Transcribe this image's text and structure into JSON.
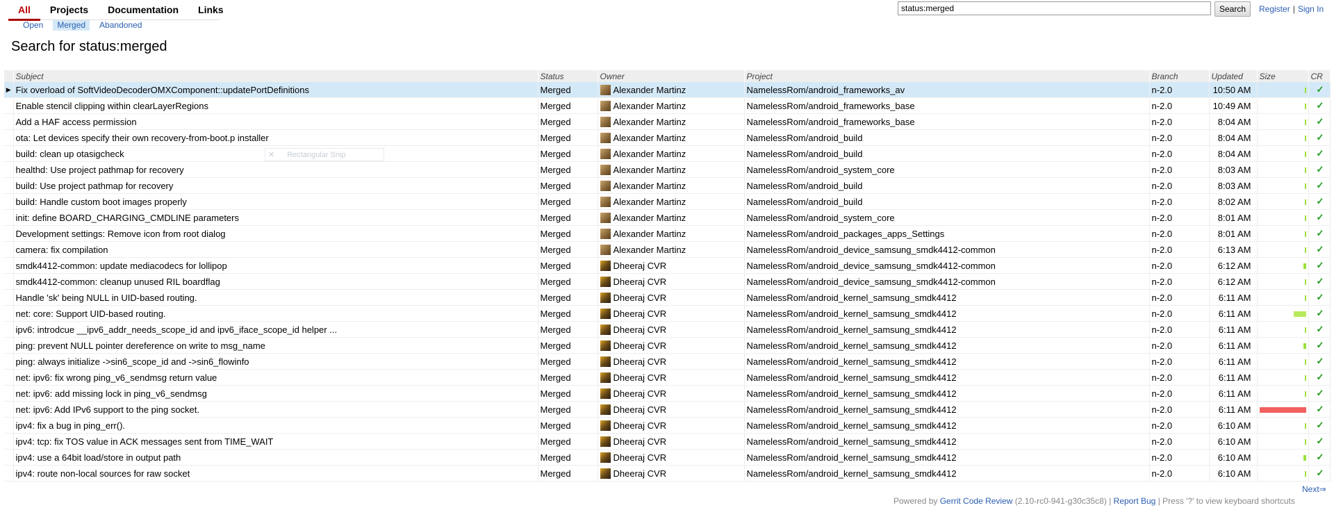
{
  "nav": {
    "tabs": [
      {
        "label": "All",
        "active": true
      },
      {
        "label": "Projects",
        "active": false
      },
      {
        "label": "Documentation",
        "active": false
      },
      {
        "label": "Links",
        "active": false
      }
    ],
    "subtabs": [
      {
        "label": "Open",
        "active": false
      },
      {
        "label": "Merged",
        "active": true
      },
      {
        "label": "Abandoned",
        "active": false
      }
    ]
  },
  "search": {
    "value": "status:merged",
    "button_label": "Search"
  },
  "user_links": {
    "register": "Register",
    "separator": "|",
    "sign_in": "Sign In"
  },
  "page_title": "Search for status:merged",
  "columns": {
    "subject": "Subject",
    "status": "Status",
    "owner": "Owner",
    "project": "Project",
    "branch": "Branch",
    "updated": "Updated",
    "size": "Size",
    "cr": "CR"
  },
  "rows": [
    {
      "subject": "Fix overload of SoftVideoDecoderOMXComponent::updatePortDefinitions",
      "status": "Merged",
      "owner": "Alexander Martinz",
      "project": "NamelessRom/android_frameworks_av",
      "branch": "n-2.0",
      "updated": "10:50 AM",
      "size_fraction": 0.03,
      "size_color": "#99e03a",
      "cr": "✓"
    },
    {
      "subject": "Enable stencil clipping within clearLayerRegions",
      "status": "Merged",
      "owner": "Alexander Martinz",
      "project": "NamelessRom/android_frameworks_base",
      "branch": "n-2.0",
      "updated": "10:49 AM",
      "size_fraction": 0.03,
      "size_color": "#99e03a",
      "cr": "✓"
    },
    {
      "subject": "Add a HAF access permission",
      "status": "Merged",
      "owner": "Alexander Martinz",
      "project": "NamelessRom/android_frameworks_base",
      "branch": "n-2.0",
      "updated": "8:04 AM",
      "size_fraction": 0.03,
      "size_color": "#99e03a",
      "cr": "✓"
    },
    {
      "subject": "ota: Let devices specify their own recovery-from-boot.p installer",
      "status": "Merged",
      "owner": "Alexander Martinz",
      "project": "NamelessRom/android_build",
      "branch": "n-2.0",
      "updated": "8:04 AM",
      "size_fraction": 0.03,
      "size_color": "#99e03a",
      "cr": "✓"
    },
    {
      "subject": "build: clean up otasigcheck",
      "status": "Merged",
      "owner": "Alexander Martinz",
      "project": "NamelessRom/android_build",
      "branch": "n-2.0",
      "updated": "8:04 AM",
      "size_fraction": 0.03,
      "size_color": "#99e03a",
      "cr": "✓"
    },
    {
      "subject": "healthd: Use project pathmap for recovery",
      "status": "Merged",
      "owner": "Alexander Martinz",
      "project": "NamelessRom/android_system_core",
      "branch": "n-2.0",
      "updated": "8:03 AM",
      "size_fraction": 0.03,
      "size_color": "#99e03a",
      "cr": "✓"
    },
    {
      "subject": "build: Use project pathmap for recovery",
      "status": "Merged",
      "owner": "Alexander Martinz",
      "project": "NamelessRom/android_build",
      "branch": "n-2.0",
      "updated": "8:03 AM",
      "size_fraction": 0.03,
      "size_color": "#99e03a",
      "cr": "✓"
    },
    {
      "subject": "build: Handle custom boot images properly",
      "status": "Merged",
      "owner": "Alexander Martinz",
      "project": "NamelessRom/android_build",
      "branch": "n-2.0",
      "updated": "8:02 AM",
      "size_fraction": 0.03,
      "size_color": "#99e03a",
      "cr": "✓"
    },
    {
      "subject": "init: define BOARD_CHARGING_CMDLINE parameters",
      "status": "Merged",
      "owner": "Alexander Martinz",
      "project": "NamelessRom/android_system_core",
      "branch": "n-2.0",
      "updated": "8:01 AM",
      "size_fraction": 0.03,
      "size_color": "#99e03a",
      "cr": "✓"
    },
    {
      "subject": "Development settings: Remove icon from root dialog",
      "status": "Merged",
      "owner": "Alexander Martinz",
      "project": "NamelessRom/android_packages_apps_Settings",
      "branch": "n-2.0",
      "updated": "8:01 AM",
      "size_fraction": 0.03,
      "size_color": "#99e03a",
      "cr": "✓"
    },
    {
      "subject": "camera: fix compilation",
      "status": "Merged",
      "owner": "Alexander Martinz",
      "project": "NamelessRom/android_device_samsung_smdk4412-common",
      "branch": "n-2.0",
      "updated": "6:13 AM",
      "size_fraction": 0.03,
      "size_color": "#99e03a",
      "cr": "✓"
    },
    {
      "subject": "smdk4412-common: update mediacodecs for lollipop",
      "status": "Merged",
      "owner": "Dheeraj CVR",
      "project": "NamelessRom/android_device_samsung_smdk4412-common",
      "branch": "n-2.0",
      "updated": "6:12 AM",
      "size_fraction": 0.05,
      "size_color": "#99e03a",
      "cr": "✓"
    },
    {
      "subject": "smdk4412-common: cleanup unused RIL boardflag",
      "status": "Merged",
      "owner": "Dheeraj CVR",
      "project": "NamelessRom/android_device_samsung_smdk4412-common",
      "branch": "n-2.0",
      "updated": "6:12 AM",
      "size_fraction": 0.03,
      "size_color": "#99e03a",
      "cr": "✓"
    },
    {
      "subject": "Handle 'sk' being NULL in UID-based routing.",
      "status": "Merged",
      "owner": "Dheeraj CVR",
      "project": "NamelessRom/android_kernel_samsung_smdk4412",
      "branch": "n-2.0",
      "updated": "6:11 AM",
      "size_fraction": 0.03,
      "size_color": "#99e03a",
      "cr": "✓"
    },
    {
      "subject": "net: core: Support UID-based routing.",
      "status": "Merged",
      "owner": "Dheeraj CVR",
      "project": "NamelessRom/android_kernel_samsung_smdk4412",
      "branch": "n-2.0",
      "updated": "6:11 AM",
      "size_fraction": 0.25,
      "size_color": "#b8ea5c",
      "cr": "✓"
    },
    {
      "subject": "ipv6: introdcue __ipv6_addr_needs_scope_id and ipv6_iface_scope_id helper ...",
      "status": "Merged",
      "owner": "Dheeraj CVR",
      "project": "NamelessRom/android_kernel_samsung_smdk4412",
      "branch": "n-2.0",
      "updated": "6:11 AM",
      "size_fraction": 0.03,
      "size_color": "#99e03a",
      "cr": "✓"
    },
    {
      "subject": "ping: prevent NULL pointer dereference on write to msg_name",
      "status": "Merged",
      "owner": "Dheeraj CVR",
      "project": "NamelessRom/android_kernel_samsung_smdk4412",
      "branch": "n-2.0",
      "updated": "6:11 AM",
      "size_fraction": 0.05,
      "size_color": "#99e03a",
      "cr": "✓"
    },
    {
      "subject": "ping: always initialize ->sin6_scope_id and ->sin6_flowinfo",
      "status": "Merged",
      "owner": "Dheeraj CVR",
      "project": "NamelessRom/android_kernel_samsung_smdk4412",
      "branch": "n-2.0",
      "updated": "6:11 AM",
      "size_fraction": 0.03,
      "size_color": "#99e03a",
      "cr": "✓"
    },
    {
      "subject": "net: ipv6: fix wrong ping_v6_sendmsg return value",
      "status": "Merged",
      "owner": "Dheeraj CVR",
      "project": "NamelessRom/android_kernel_samsung_smdk4412",
      "branch": "n-2.0",
      "updated": "6:11 AM",
      "size_fraction": 0.03,
      "size_color": "#99e03a",
      "cr": "✓"
    },
    {
      "subject": "net: ipv6: add missing lock in ping_v6_sendmsg",
      "status": "Merged",
      "owner": "Dheeraj CVR",
      "project": "NamelessRom/android_kernel_samsung_smdk4412",
      "branch": "n-2.0",
      "updated": "6:11 AM",
      "size_fraction": 0.03,
      "size_color": "#99e03a",
      "cr": "✓"
    },
    {
      "subject": "net: ipv6: Add IPv6 support to the ping socket.",
      "status": "Merged",
      "owner": "Dheeraj CVR",
      "project": "NamelessRom/android_kernel_samsung_smdk4412",
      "branch": "n-2.0",
      "updated": "6:11 AM",
      "size_fraction": 0.95,
      "size_color": "#f26060",
      "cr": "✓"
    },
    {
      "subject": "ipv4: fix a bug in ping_err().",
      "status": "Merged",
      "owner": "Dheeraj CVR",
      "project": "NamelessRom/android_kernel_samsung_smdk4412",
      "branch": "n-2.0",
      "updated": "6:10 AM",
      "size_fraction": 0.03,
      "size_color": "#99e03a",
      "cr": "✓"
    },
    {
      "subject": "ipv4: tcp: fix TOS value in ACK messages sent from TIME_WAIT",
      "status": "Merged",
      "owner": "Dheeraj CVR",
      "project": "NamelessRom/android_kernel_samsung_smdk4412",
      "branch": "n-2.0",
      "updated": "6:10 AM",
      "size_fraction": 0.03,
      "size_color": "#99e03a",
      "cr": "✓"
    },
    {
      "subject": "ipv4: use a 64bit load/store in output path",
      "status": "Merged",
      "owner": "Dheeraj CVR",
      "project": "NamelessRom/android_kernel_samsung_smdk4412",
      "branch": "n-2.0",
      "updated": "6:10 AM",
      "size_fraction": 0.05,
      "size_color": "#99e03a",
      "cr": "✓"
    },
    {
      "subject": "ipv4: route non-local sources for raw socket",
      "status": "Merged",
      "owner": "Dheeraj CVR",
      "project": "NamelessRom/android_kernel_samsung_smdk4412",
      "branch": "n-2.0",
      "updated": "6:10 AM",
      "size_fraction": 0.03,
      "size_color": "#99e03a",
      "cr": "✓"
    }
  ],
  "selected_row": 0,
  "snip_overlay": {
    "icon": "close-icon",
    "label": "Rectangular Snip"
  },
  "pager": {
    "next": "Next⇒"
  },
  "footer": {
    "powered_by": "Powered by",
    "gerrit": "Gerrit Code Review",
    "version": "(2.10-rc0-941-g30c35c8)",
    "sep1": "|",
    "report_bug": "Report Bug",
    "sep2": "|",
    "shortcuts_hint": "Press '?' to view keyboard shortcuts"
  }
}
